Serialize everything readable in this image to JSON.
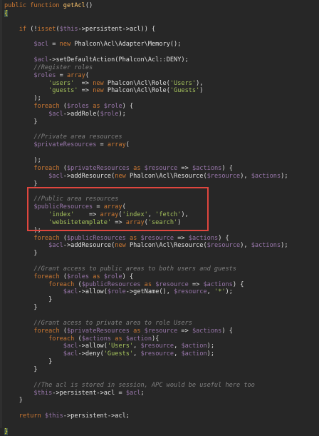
{
  "editor": {
    "lines": [
      {
        "indent": "",
        "tokens": [
          {
            "t": "public function ",
            "c": "kw"
          },
          {
            "t": "getAcl",
            "c": "fn"
          },
          {
            "t": "()",
            "c": "pl"
          }
        ]
      },
      {
        "indent": "",
        "tokens": [
          {
            "t": "{",
            "c": "brace-hl"
          }
        ]
      },
      {
        "indent": "",
        "tokens": []
      },
      {
        "indent": "    ",
        "tokens": [
          {
            "t": "if ",
            "c": "kw"
          },
          {
            "t": "(!",
            "c": "pl"
          },
          {
            "t": "isset",
            "c": "kw"
          },
          {
            "t": "(",
            "c": "pl"
          },
          {
            "t": "$this",
            "c": "var"
          },
          {
            "t": "->",
            "c": "pl"
          },
          {
            "t": "persistent",
            "c": "pl"
          },
          {
            "t": "->",
            "c": "pl"
          },
          {
            "t": "acl",
            "c": "pl"
          },
          {
            "t": ")) {",
            "c": "pl"
          }
        ]
      },
      {
        "indent": "",
        "tokens": []
      },
      {
        "indent": "        ",
        "tokens": [
          {
            "t": "$acl",
            "c": "var"
          },
          {
            "t": " = ",
            "c": "pl"
          },
          {
            "t": "new ",
            "c": "kw"
          },
          {
            "t": "Phalcon\\Acl\\Adapter\\Memory",
            "c": "pl"
          },
          {
            "t": "();",
            "c": "pl"
          }
        ]
      },
      {
        "indent": "",
        "tokens": []
      },
      {
        "indent": "        ",
        "tokens": [
          {
            "t": "$acl",
            "c": "var"
          },
          {
            "t": "->",
            "c": "pl"
          },
          {
            "t": "setDefaultAction",
            "c": "pl"
          },
          {
            "t": "(Phalcon\\Acl::",
            "c": "pl"
          },
          {
            "t": "DENY",
            "c": "pl"
          },
          {
            "t": ");",
            "c": "pl"
          }
        ]
      },
      {
        "indent": "        ",
        "tokens": [
          {
            "t": "//Register roles",
            "c": "cm"
          }
        ]
      },
      {
        "indent": "        ",
        "tokens": [
          {
            "t": "$roles",
            "c": "var"
          },
          {
            "t": " = ",
            "c": "pl"
          },
          {
            "t": "array",
            "c": "kw"
          },
          {
            "t": "(",
            "c": "pl"
          }
        ]
      },
      {
        "indent": "            ",
        "tokens": [
          {
            "t": "'users'",
            "c": "str"
          },
          {
            "t": "  => ",
            "c": "pl"
          },
          {
            "t": "new ",
            "c": "kw"
          },
          {
            "t": "Phalcon\\Acl\\Role(",
            "c": "pl"
          },
          {
            "t": "'Users'",
            "c": "str"
          },
          {
            "t": "),",
            "c": "pl"
          }
        ]
      },
      {
        "indent": "            ",
        "tokens": [
          {
            "t": "'guests'",
            "c": "str"
          },
          {
            "t": " => ",
            "c": "pl"
          },
          {
            "t": "new ",
            "c": "kw"
          },
          {
            "t": "Phalcon\\Acl\\Role(",
            "c": "pl"
          },
          {
            "t": "'Guests'",
            "c": "str"
          },
          {
            "t": ")",
            "c": "pl"
          }
        ]
      },
      {
        "indent": "        ",
        "tokens": [
          {
            "t": ");",
            "c": "pl"
          }
        ]
      },
      {
        "indent": "        ",
        "tokens": [
          {
            "t": "foreach ",
            "c": "kw"
          },
          {
            "t": "(",
            "c": "pl"
          },
          {
            "t": "$roles",
            "c": "var"
          },
          {
            "t": " as ",
            "c": "kw"
          },
          {
            "t": "$role",
            "c": "var"
          },
          {
            "t": ") {",
            "c": "pl"
          }
        ]
      },
      {
        "indent": "            ",
        "tokens": [
          {
            "t": "$acl",
            "c": "var"
          },
          {
            "t": "->",
            "c": "pl"
          },
          {
            "t": "addRole",
            "c": "pl"
          },
          {
            "t": "(",
            "c": "pl"
          },
          {
            "t": "$role",
            "c": "var"
          },
          {
            "t": ");",
            "c": "pl"
          }
        ]
      },
      {
        "indent": "        ",
        "tokens": [
          {
            "t": "}",
            "c": "pl"
          }
        ]
      },
      {
        "indent": "",
        "tokens": []
      },
      {
        "indent": "        ",
        "tokens": [
          {
            "t": "//Private area resources",
            "c": "cm"
          }
        ]
      },
      {
        "indent": "        ",
        "tokens": [
          {
            "t": "$privateResources",
            "c": "var"
          },
          {
            "t": " = ",
            "c": "pl"
          },
          {
            "t": "array",
            "c": "kw"
          },
          {
            "t": "(",
            "c": "pl"
          }
        ]
      },
      {
        "indent": "",
        "tokens": []
      },
      {
        "indent": "        ",
        "tokens": [
          {
            "t": ");",
            "c": "pl"
          }
        ]
      },
      {
        "indent": "        ",
        "tokens": [
          {
            "t": "foreach ",
            "c": "kw"
          },
          {
            "t": "(",
            "c": "pl"
          },
          {
            "t": "$privateResources",
            "c": "var"
          },
          {
            "t": " as ",
            "c": "kw"
          },
          {
            "t": "$resource",
            "c": "var"
          },
          {
            "t": " => ",
            "c": "pl"
          },
          {
            "t": "$actions",
            "c": "var"
          },
          {
            "t": ") {",
            "c": "pl"
          }
        ]
      },
      {
        "indent": "            ",
        "tokens": [
          {
            "t": "$acl",
            "c": "var"
          },
          {
            "t": "->",
            "c": "pl"
          },
          {
            "t": "addResource",
            "c": "pl"
          },
          {
            "t": "(",
            "c": "pl"
          },
          {
            "t": "new ",
            "c": "kw"
          },
          {
            "t": "Phalcon\\Acl\\Resource(",
            "c": "pl"
          },
          {
            "t": "$resource",
            "c": "var"
          },
          {
            "t": "), ",
            "c": "pl"
          },
          {
            "t": "$actions",
            "c": "var"
          },
          {
            "t": ");",
            "c": "pl"
          }
        ]
      },
      {
        "indent": "        ",
        "tokens": [
          {
            "t": "}",
            "c": "pl"
          }
        ]
      },
      {
        "indent": "",
        "tokens": []
      },
      {
        "indent": "        ",
        "tokens": [
          {
            "t": "//Public area resources",
            "c": "cm"
          }
        ]
      },
      {
        "indent": "        ",
        "tokens": [
          {
            "t": "$publicResources",
            "c": "var"
          },
          {
            "t": " = ",
            "c": "pl"
          },
          {
            "t": "array",
            "c": "kw"
          },
          {
            "t": "(",
            "c": "pl"
          }
        ]
      },
      {
        "indent": "            ",
        "tokens": [
          {
            "t": "'index'",
            "c": "str"
          },
          {
            "t": "    => ",
            "c": "pl"
          },
          {
            "t": "array",
            "c": "kw"
          },
          {
            "t": "(",
            "c": "pl"
          },
          {
            "t": "'index'",
            "c": "str"
          },
          {
            "t": ", ",
            "c": "pl"
          },
          {
            "t": "'fetch'",
            "c": "str"
          },
          {
            "t": "),",
            "c": "pl"
          }
        ]
      },
      {
        "indent": "            ",
        "tokens": [
          {
            "t": "'websitetemplate'",
            "c": "str"
          },
          {
            "t": " => ",
            "c": "pl"
          },
          {
            "t": "array",
            "c": "kw"
          },
          {
            "t": "(",
            "c": "pl"
          },
          {
            "t": "'search'",
            "c": "str"
          },
          {
            "t": ")",
            "c": "pl"
          }
        ]
      },
      {
        "indent": "        ",
        "tokens": [
          {
            "t": ");",
            "c": "pl"
          }
        ]
      },
      {
        "indent": "        ",
        "tokens": [
          {
            "t": "foreach ",
            "c": "kw"
          },
          {
            "t": "(",
            "c": "pl"
          },
          {
            "t": "$publicResources",
            "c": "var"
          },
          {
            "t": " as ",
            "c": "kw"
          },
          {
            "t": "$resource",
            "c": "var"
          },
          {
            "t": " => ",
            "c": "pl"
          },
          {
            "t": "$actions",
            "c": "var"
          },
          {
            "t": ") {",
            "c": "pl"
          }
        ]
      },
      {
        "indent": "            ",
        "tokens": [
          {
            "t": "$acl",
            "c": "var"
          },
          {
            "t": "->",
            "c": "pl"
          },
          {
            "t": "addResource",
            "c": "pl"
          },
          {
            "t": "(",
            "c": "pl"
          },
          {
            "t": "new ",
            "c": "kw"
          },
          {
            "t": "Phalcon\\Acl\\Resource(",
            "c": "pl"
          },
          {
            "t": "$resource",
            "c": "var"
          },
          {
            "t": "), ",
            "c": "pl"
          },
          {
            "t": "$actions",
            "c": "var"
          },
          {
            "t": ");",
            "c": "pl"
          }
        ]
      },
      {
        "indent": "        ",
        "tokens": [
          {
            "t": "}",
            "c": "pl"
          }
        ]
      },
      {
        "indent": "",
        "tokens": []
      },
      {
        "indent": "        ",
        "tokens": [
          {
            "t": "//Grant access to public areas to both users and guests",
            "c": "cm"
          }
        ]
      },
      {
        "indent": "        ",
        "tokens": [
          {
            "t": "foreach ",
            "c": "kw"
          },
          {
            "t": "(",
            "c": "pl"
          },
          {
            "t": "$roles",
            "c": "var"
          },
          {
            "t": " as ",
            "c": "kw"
          },
          {
            "t": "$role",
            "c": "var"
          },
          {
            "t": ") {",
            "c": "pl"
          }
        ]
      },
      {
        "indent": "            ",
        "tokens": [
          {
            "t": "foreach ",
            "c": "kw"
          },
          {
            "t": "(",
            "c": "pl"
          },
          {
            "t": "$publicResources",
            "c": "var"
          },
          {
            "t": " as ",
            "c": "kw"
          },
          {
            "t": "$resource",
            "c": "var"
          },
          {
            "t": " => ",
            "c": "pl"
          },
          {
            "t": "$actions",
            "c": "var"
          },
          {
            "t": ") {",
            "c": "pl"
          }
        ]
      },
      {
        "indent": "                ",
        "tokens": [
          {
            "t": "$acl",
            "c": "var"
          },
          {
            "t": "->",
            "c": "pl"
          },
          {
            "t": "allow",
            "c": "pl"
          },
          {
            "t": "(",
            "c": "pl"
          },
          {
            "t": "$role",
            "c": "var"
          },
          {
            "t": "->",
            "c": "pl"
          },
          {
            "t": "getName",
            "c": "pl"
          },
          {
            "t": "(), ",
            "c": "pl"
          },
          {
            "t": "$resource",
            "c": "var"
          },
          {
            "t": ", ",
            "c": "pl"
          },
          {
            "t": "'*'",
            "c": "str"
          },
          {
            "t": ");",
            "c": "pl"
          }
        ]
      },
      {
        "indent": "            ",
        "tokens": [
          {
            "t": "}",
            "c": "pl"
          }
        ]
      },
      {
        "indent": "        ",
        "tokens": [
          {
            "t": "}",
            "c": "pl"
          }
        ]
      },
      {
        "indent": "",
        "tokens": []
      },
      {
        "indent": "        ",
        "tokens": [
          {
            "t": "//Grant acess to private area to role Users",
            "c": "cm"
          }
        ]
      },
      {
        "indent": "        ",
        "tokens": [
          {
            "t": "foreach ",
            "c": "kw"
          },
          {
            "t": "(",
            "c": "pl"
          },
          {
            "t": "$privateResources",
            "c": "var"
          },
          {
            "t": " as ",
            "c": "kw"
          },
          {
            "t": "$resource",
            "c": "var"
          },
          {
            "t": " => ",
            "c": "pl"
          },
          {
            "t": "$actions",
            "c": "var"
          },
          {
            "t": ") {",
            "c": "pl"
          }
        ]
      },
      {
        "indent": "            ",
        "tokens": [
          {
            "t": "foreach ",
            "c": "kw"
          },
          {
            "t": "(",
            "c": "pl"
          },
          {
            "t": "$actions",
            "c": "var"
          },
          {
            "t": " as ",
            "c": "kw"
          },
          {
            "t": "$action",
            "c": "var"
          },
          {
            "t": "){",
            "c": "pl"
          }
        ]
      },
      {
        "indent": "                ",
        "tokens": [
          {
            "t": "$acl",
            "c": "var"
          },
          {
            "t": "->",
            "c": "pl"
          },
          {
            "t": "allow",
            "c": "pl"
          },
          {
            "t": "(",
            "c": "pl"
          },
          {
            "t": "'Users'",
            "c": "str"
          },
          {
            "t": ", ",
            "c": "pl"
          },
          {
            "t": "$resource",
            "c": "var"
          },
          {
            "t": ", ",
            "c": "pl"
          },
          {
            "t": "$action",
            "c": "var"
          },
          {
            "t": ");",
            "c": "pl"
          }
        ]
      },
      {
        "indent": "                ",
        "tokens": [
          {
            "t": "$acl",
            "c": "var"
          },
          {
            "t": "->",
            "c": "pl"
          },
          {
            "t": "deny",
            "c": "pl"
          },
          {
            "t": "(",
            "c": "pl"
          },
          {
            "t": "'Guests'",
            "c": "str"
          },
          {
            "t": ", ",
            "c": "pl"
          },
          {
            "t": "$resource",
            "c": "var"
          },
          {
            "t": ", ",
            "c": "pl"
          },
          {
            "t": "$action",
            "c": "var"
          },
          {
            "t": ");",
            "c": "pl"
          }
        ]
      },
      {
        "indent": "            ",
        "tokens": [
          {
            "t": "}",
            "c": "pl"
          }
        ]
      },
      {
        "indent": "        ",
        "tokens": [
          {
            "t": "}",
            "c": "pl"
          }
        ]
      },
      {
        "indent": "",
        "tokens": []
      },
      {
        "indent": "        ",
        "tokens": [
          {
            "t": "//The acl is stored in session, APC would be useful here too",
            "c": "cm"
          }
        ]
      },
      {
        "indent": "        ",
        "tokens": [
          {
            "t": "$this",
            "c": "var"
          },
          {
            "t": "->",
            "c": "pl"
          },
          {
            "t": "persistent",
            "c": "pl"
          },
          {
            "t": "->",
            "c": "pl"
          },
          {
            "t": "acl",
            "c": "pl"
          },
          {
            "t": " = ",
            "c": "pl"
          },
          {
            "t": "$acl",
            "c": "var"
          },
          {
            "t": ";",
            "c": "pl"
          }
        ]
      },
      {
        "indent": "    ",
        "tokens": [
          {
            "t": "}",
            "c": "pl"
          }
        ]
      },
      {
        "indent": "",
        "tokens": []
      },
      {
        "indent": "    ",
        "tokens": [
          {
            "t": "return ",
            "c": "kw"
          },
          {
            "t": "$this",
            "c": "var"
          },
          {
            "t": "->",
            "c": "pl"
          },
          {
            "t": "persistent",
            "c": "pl"
          },
          {
            "t": "->",
            "c": "pl"
          },
          {
            "t": "acl",
            "c": "pl"
          },
          {
            "t": ";",
            "c": "pl"
          }
        ]
      },
      {
        "indent": "",
        "tokens": []
      },
      {
        "indent": "",
        "tokens": [
          {
            "t": "}",
            "c": "brace-hl"
          }
        ]
      }
    ]
  },
  "colors": {
    "background": "#272727",
    "keyword": "#cc7832",
    "variable": "#9876aa",
    "string": "#a5c25c",
    "comment": "#808080",
    "highlight_box": "#e0463e"
  }
}
